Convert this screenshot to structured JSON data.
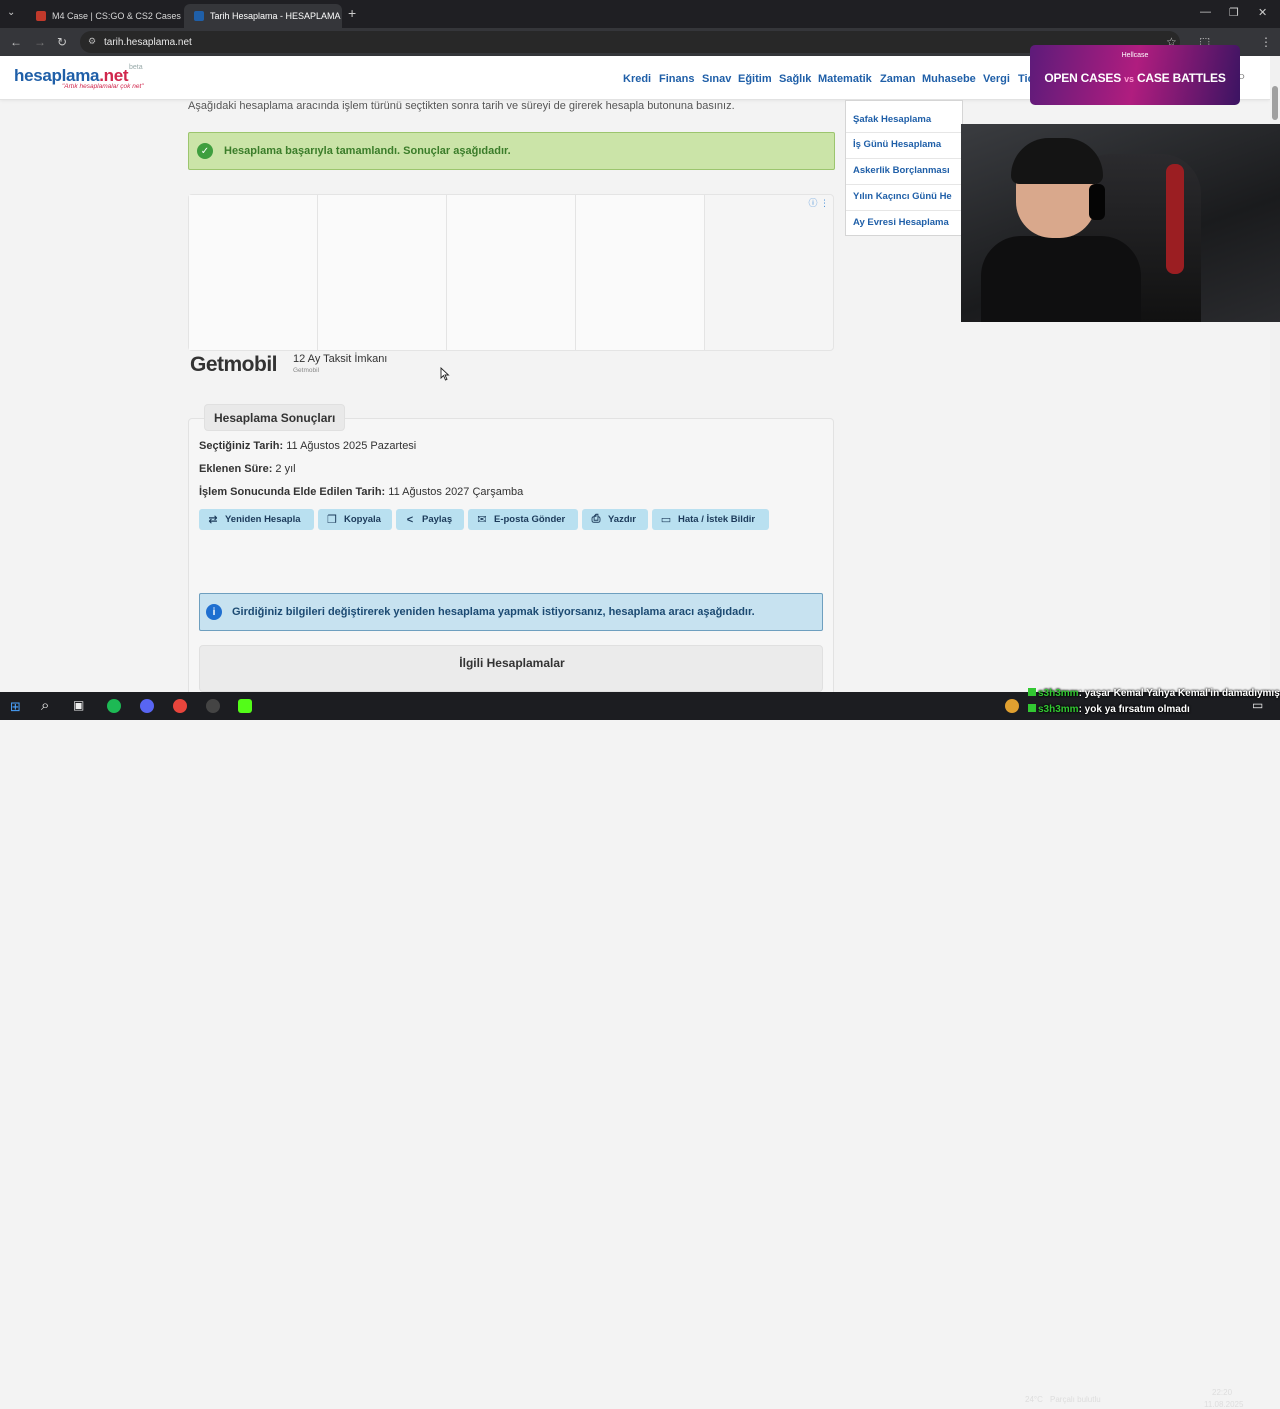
{
  "browser": {
    "tabs": [
      {
        "title": "M4 Case | CS:GO & CS2 Cases I",
        "active": false,
        "favicon_color": "#c0392b"
      },
      {
        "title": "Tarih Hesaplama - HESAPLAMA",
        "active": true,
        "favicon_color": "#1f5fa8"
      }
    ],
    "url": "tarih.hesaplama.net"
  },
  "site": {
    "logo_main": "hesaplama",
    "logo_tld": ".net",
    "logo_beta": "beta",
    "logo_tagline": "\"Artık hesaplamalar çok net\"",
    "nav": [
      "Kredi",
      "Finans",
      "Sınav",
      "Eğitim",
      "Sağlık",
      "Matematik",
      "Zaman",
      "Muhasebe",
      "Vergi",
      "Tic"
    ]
  },
  "content": {
    "intro": "Aşağıdaki hesaplama aracında işlem türünü seçtikten sonra tarih ve süreyi de girerek hesapla butonuna basınız.",
    "success_message": "Hesaplama başarıyla tamamlandı. Sonuçlar aşağıdadır.",
    "ad": {
      "brand": "Getmobil",
      "title": "12 Ay Taksit İmkanı",
      "subtitle": "Getmobil",
      "info": "ⓘ ⋮"
    },
    "results": {
      "heading": "Hesaplama Sonuçları",
      "selected_date_label": "Seçtiğiniz Tarih:",
      "selected_date_value": "11 Ağustos 2025 Pazartesi",
      "added_duration_label": "Eklenen Süre:",
      "added_duration_value": "2 yıl",
      "result_date_label": "İşlem Sonucunda Elde Edilen Tarih:",
      "result_date_value": "11 Ağustos 2027 Çarşamba"
    },
    "buttons": [
      {
        "label": "Yeniden Hesapla",
        "icon": "recalculate-icon",
        "glyph": "⇄"
      },
      {
        "label": "Kopyala",
        "icon": "copy-icon",
        "glyph": "❐"
      },
      {
        "label": "Paylaş",
        "icon": "share-icon",
        "glyph": "<"
      },
      {
        "label": "E-posta Gönder",
        "icon": "email-icon",
        "glyph": "✉"
      },
      {
        "label": "Yazdır",
        "icon": "print-icon",
        "glyph": "⎙"
      },
      {
        "label": "Hata / İstek Bildir",
        "icon": "feedback-icon",
        "glyph": "▭"
      }
    ],
    "info_message": "Girdiğiniz bilgileri değiştirerek yeniden hesaplama yapmak istiyorsanız, hesaplama aracı aşağıdadır.",
    "related_heading": "İlgili Hesaplamalar"
  },
  "sidebar": {
    "items": [
      "Şafak Hesaplama",
      "İş Günü Hesaplama",
      "Askerlik Borçlanması",
      "Yılın Kaçıncı Günü He",
      "Ay Evresi Hesaplama"
    ]
  },
  "overlay": {
    "banner_brand": "Hellcase",
    "banner_text_left": "OPEN CASES",
    "banner_vs": "vs",
    "banner_text_right": "CASE BATTLES",
    "chat": [
      {
        "user": "s3h3mm",
        "message": ": yaşar Kemal Yahya Kemal'in damadıymış"
      },
      {
        "user": "s3h3mm",
        "message": ": yok ya fırsatım olmadı"
      }
    ]
  },
  "taskbar": {
    "weather": "24°C",
    "weather_desc": "Parçalı bulutlu",
    "time": "22:20",
    "date": "11.08.2025"
  },
  "colors": {
    "brand_blue": "#1f5fa8",
    "brand_red": "#d0264c",
    "success_bg": "#cbe4a8",
    "info_bg": "#c7e2f0",
    "button_bg": "#b9e0f0"
  }
}
